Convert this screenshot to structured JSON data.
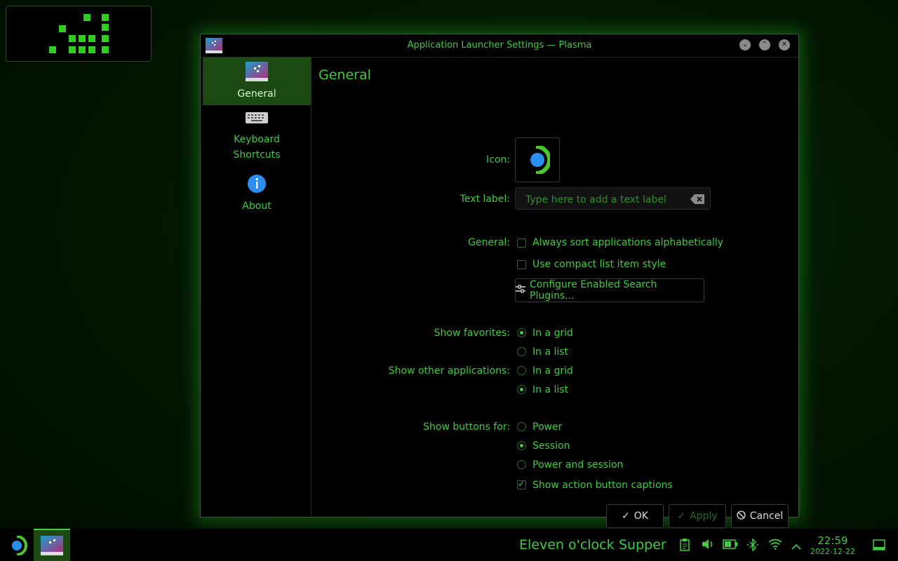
{
  "window": {
    "title": "Application Launcher Settings — Plasma"
  },
  "sidebar": {
    "items": [
      {
        "label": "General",
        "icon": "app-launcher-icon",
        "active": true
      },
      {
        "label": "Keyboard\nShortcuts",
        "label_line1": "Keyboard",
        "label_line2": "Shortcuts",
        "icon": "keyboard-icon"
      },
      {
        "label": "About",
        "icon": "info-icon"
      }
    ]
  },
  "page": {
    "title": "General",
    "icon_label": "Icon:",
    "text_label_label": "Text label:",
    "text_label_placeholder": "Type here to add a text label",
    "text_label_value": "",
    "general_label": "General:",
    "sort_alphabetically": {
      "label": "Always sort applications alphabetically",
      "checked": false
    },
    "compact_list": {
      "label": "Use compact list item style",
      "checked": false
    },
    "configure_plugins_button": "Configure Enabled Search Plugins...",
    "show_favorites": {
      "label": "Show favorites:",
      "options": [
        "In a grid",
        "In a list"
      ],
      "selected": "In a grid"
    },
    "show_other_apps": {
      "label": "Show other applications:",
      "options": [
        "In a grid",
        "In a list"
      ],
      "selected": "In a list"
    },
    "show_buttons_for": {
      "label": "Show buttons for:",
      "options": [
        "Power",
        "Session",
        "Power and session"
      ],
      "selected": "Session"
    },
    "show_action_captions": {
      "label": "Show action button captions",
      "checked": true
    }
  },
  "footer": {
    "ok_label": "OK",
    "apply_label": "Apply",
    "cancel_label": "Cancel"
  },
  "taskbar": {
    "text1": "Eleven o'clock",
    "text2": "Supper",
    "time": "22:59",
    "date": "2022-12-22"
  },
  "colors": {
    "accent": "#3fcc3f",
    "active_bg": "#1d4a12",
    "launcher_blue": "#2b8ef0"
  }
}
